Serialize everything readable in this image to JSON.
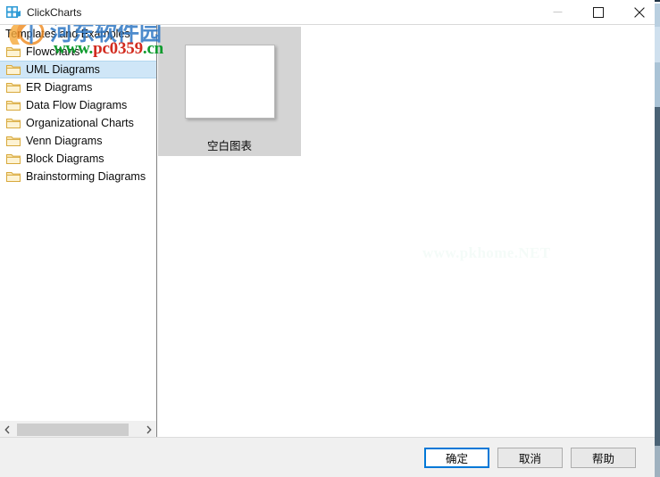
{
  "window": {
    "title": "ClickCharts",
    "icon": "clickcharts-app-icon",
    "minimize_label": "—",
    "maximize_label": "□",
    "close_label": "✕"
  },
  "watermarks": {
    "brand_cn": "河东软件园",
    "url_www": "www.",
    "url_host": "pc0359",
    "url_tld": ".cn",
    "center_faint": "www.pkhome.NET"
  },
  "sidebar": {
    "root_label": "Templates and Examples",
    "items": [
      {
        "label": "Flowcharts",
        "icon": "folder-icon",
        "selected": false
      },
      {
        "label": "UML Diagrams",
        "icon": "folder-icon",
        "selected": true
      },
      {
        "label": "ER Diagrams",
        "icon": "folder-icon",
        "selected": false
      },
      {
        "label": "Data Flow Diagrams",
        "icon": "folder-icon",
        "selected": false
      },
      {
        "label": "Organizational Charts",
        "icon": "folder-icon",
        "selected": false
      },
      {
        "label": "Venn Diagrams",
        "icon": "folder-icon",
        "selected": false
      },
      {
        "label": "Block Diagrams",
        "icon": "folder-icon",
        "selected": false
      },
      {
        "label": "Brainstorming Diagrams",
        "icon": "folder-icon",
        "selected": false
      }
    ],
    "scrollbar": {
      "left_arrow": "‹",
      "right_arrow": "›"
    }
  },
  "templates": {
    "items": [
      {
        "label": "空白图表",
        "selected": true
      }
    ]
  },
  "footer": {
    "buttons": [
      {
        "label": "确定",
        "name": "ok-button",
        "default": true
      },
      {
        "label": "取消",
        "name": "cancel-button",
        "default": false
      },
      {
        "label": "帮助",
        "name": "help-button",
        "default": false
      }
    ]
  },
  "colors": {
    "selection_blue": "#cfe6f7",
    "default_button_border": "#0078d7",
    "folder_yellow": "#f5d98a",
    "thumb_cell_bg": "#d4d4d4",
    "footer_bg": "#f0f0f0"
  }
}
